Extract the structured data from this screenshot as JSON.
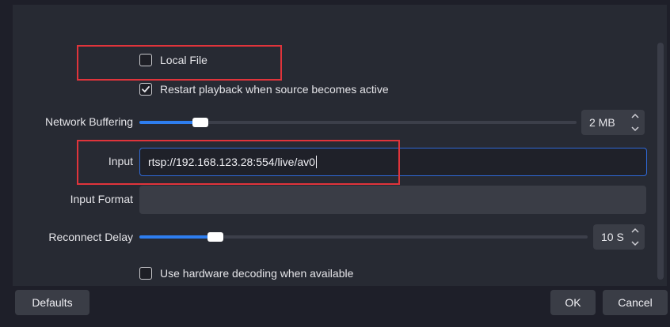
{
  "properties": {
    "local_file": {
      "label": "Local File",
      "checked": false
    },
    "restart_playback": {
      "label": "Restart playback when source becomes active",
      "checked": true
    },
    "network_buffering": {
      "label": "Network Buffering",
      "value": "2 MB",
      "slider_fraction": 0.14
    },
    "input": {
      "label": "Input",
      "value": "rtsp://192.168.123.28:554/live/av0"
    },
    "input_format": {
      "label": "Input Format",
      "value": ""
    },
    "reconnect_delay": {
      "label": "Reconnect Delay",
      "value": "10 S",
      "slider_fraction": 0.17
    },
    "hardware_decoding": {
      "label": "Use hardware decoding when available",
      "checked": false
    }
  },
  "buttons": {
    "defaults": "Defaults",
    "ok": "OK",
    "cancel": "Cancel"
  },
  "colors": {
    "accent": "#2e7ef0",
    "highlight": "#e0343b",
    "panel": "#272a33",
    "background": "#1e1f29"
  },
  "icons": {
    "checkmark": "checkmark-icon",
    "spin_up": "chevron-up-icon",
    "spin_down": "chevron-down-icon"
  }
}
